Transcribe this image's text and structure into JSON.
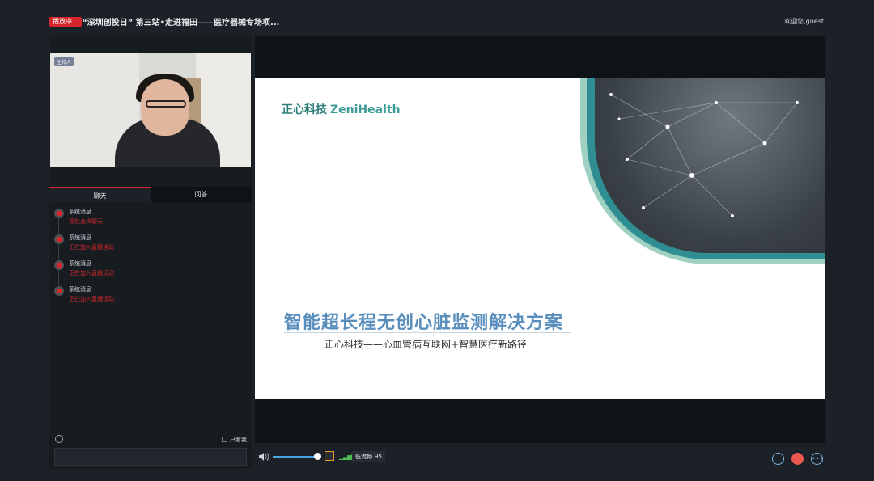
{
  "header": {
    "live_badge": "播放中...",
    "title": "“深圳创投日” 第三站•走进福田——医疗器械专场项...",
    "welcome": "欢迎您,guest"
  },
  "video": {
    "tag": "主持人"
  },
  "chat": {
    "tabs": [
      {
        "label": "聊天"
      },
      {
        "label": "问答"
      }
    ],
    "messages": [
      {
        "sender": "系统消息",
        "text": "现在允许聊天"
      },
      {
        "sender": "系统消息",
        "text": "正在加入直播活动"
      },
      {
        "sender": "系统消息",
        "text": "正在加入直播活动"
      },
      {
        "sender": "系统消息",
        "text": "正在加入直播活动"
      }
    ],
    "only_me_label": "只看我",
    "input_value": ""
  },
  "slide": {
    "brand_cn": "正心科技",
    "brand_en": "ZeniHealth",
    "title": "智能超长程无创心脏监测解决方案",
    "subtitle": "正心科技——心血管病互联网+智慧医疗新路径"
  },
  "controls": {
    "volume_percent": 95,
    "quality_label": "低流畅 H5",
    "icons": [
      "volume-icon",
      "fullscreen-icon",
      "signal-icon",
      "hand-icon",
      "like-icon",
      "more-icon"
    ],
    "more_label": "•••"
  },
  "colors": {
    "accent_red": "#d6262b",
    "brand_teal": "#2e7f7a",
    "title_blue": "#5a8fbd"
  }
}
